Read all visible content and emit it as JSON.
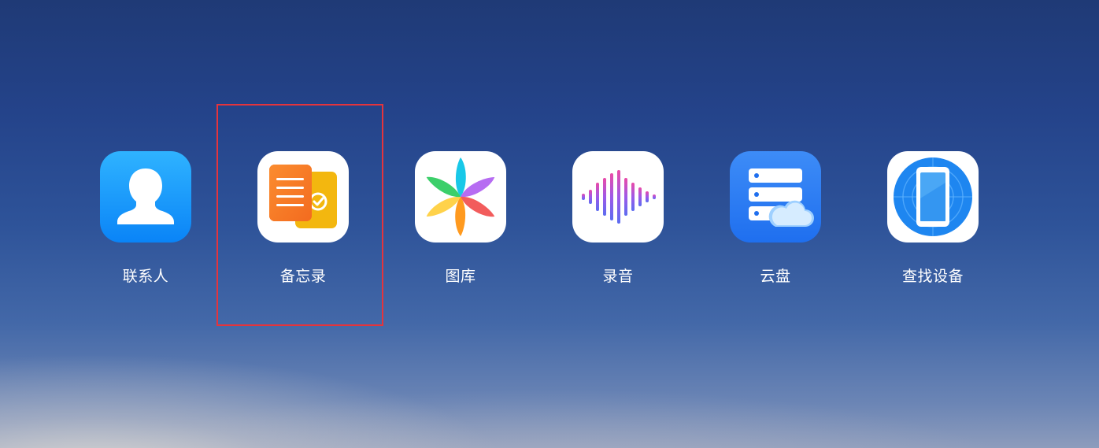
{
  "apps": [
    {
      "label": "联系人",
      "icon": "contacts-icon"
    },
    {
      "label": "备忘录",
      "icon": "notes-icon"
    },
    {
      "label": "图库",
      "icon": "gallery-icon"
    },
    {
      "label": "录音",
      "icon": "recorder-icon"
    },
    {
      "label": "云盘",
      "icon": "cloud-drive-icon"
    },
    {
      "label": "查找设备",
      "icon": "find-device-icon"
    }
  ],
  "highlight": {
    "target": "备忘录",
    "color": "#e5343c"
  },
  "colors": {
    "background_top": "#1f3a76",
    "background_bottom": "#8d9cbc",
    "label": "#ffffff",
    "contacts_tile": "#0a84f7",
    "cloud_tile": "#1f6fef"
  }
}
